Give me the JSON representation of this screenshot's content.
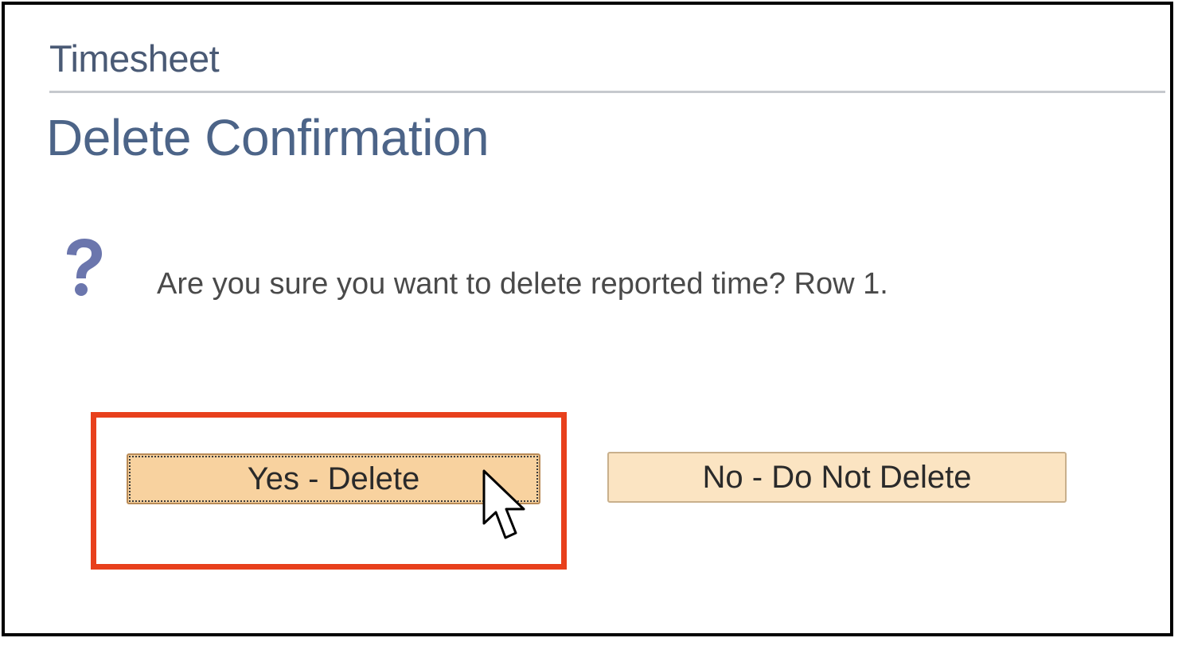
{
  "breadcrumb": {
    "title": "Timesheet"
  },
  "page": {
    "title": "Delete Confirmation"
  },
  "dialog": {
    "icon": "question-mark-icon",
    "message": "Are you sure you want to delete reported time? Row 1.",
    "confirm_label": "Yes - Delete",
    "cancel_label": "No - Do Not Delete"
  },
  "colors": {
    "title": "#4c6488",
    "highlight": "#e8401c",
    "confirm_button": "#f8d29f",
    "cancel_button": "#fbe4c2",
    "question_icon": "#6b76ad"
  }
}
